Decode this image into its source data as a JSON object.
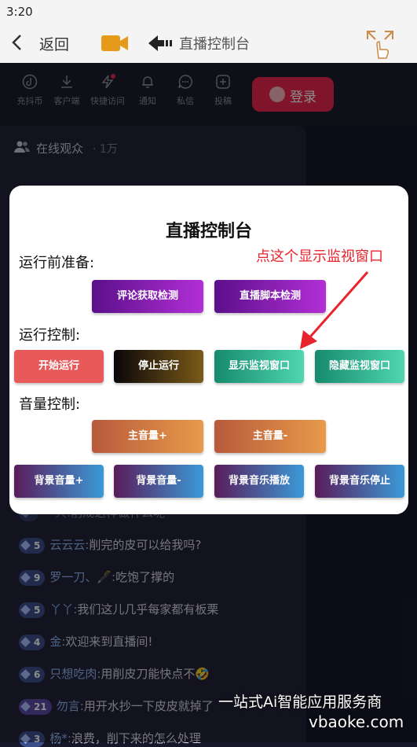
{
  "status": {
    "time": "3:20"
  },
  "header": {
    "back_label": "返回",
    "title": "直播控制台"
  },
  "appbar": {
    "items": [
      {
        "label": "充抖币",
        "icon": "tiktok-icon"
      },
      {
        "label": "客户端",
        "icon": "download-icon"
      },
      {
        "label": "快捷访问",
        "icon": "lightning-icon"
      },
      {
        "label": "通知",
        "icon": "bell-icon"
      },
      {
        "label": "私信",
        "icon": "chat-icon"
      },
      {
        "label": "投稿",
        "icon": "plus-square-icon"
      }
    ],
    "login_label": "登录"
  },
  "panel": {
    "audience_label": "在线观众",
    "audience_count": "· 1万"
  },
  "modal": {
    "title": "直播控制台",
    "annotation": "点这个显示监视窗口",
    "sections": [
      {
        "label": "运行前准备:",
        "buttons": [
          "评论获取检测",
          "直播脚本检测"
        ]
      },
      {
        "label": "运行控制:",
        "buttons": [
          "开始运行",
          "停止运行",
          "显示监视窗口",
          "隐藏监视窗口"
        ]
      },
      {
        "label": "音量控制:",
        "buttons": [
          "主音量+",
          "主音量-",
          "背景音量+",
          "背景音量-",
          "背景音乐播放",
          "背景音乐停止"
        ]
      }
    ]
  },
  "comments": [
    {
      "level": "",
      "user": "一只:",
      "text": "削成这样做什么呢"
    },
    {
      "level": "5",
      "user": "云云云:",
      "text": "削完的皮可以给我吗?"
    },
    {
      "level": "9",
      "user": "罗一刀、🖋️:",
      "text": "吃饱了撑的"
    },
    {
      "level": "5",
      "user": "丫丫:",
      "text": "我们这儿几乎每家都有板栗"
    },
    {
      "level": "4",
      "user": "金:",
      "text": "欢迎来到直播间!"
    },
    {
      "level": "6",
      "user": "只想吃肉:",
      "text": "用削皮刀能快点不🤣"
    },
    {
      "level": "21",
      "user": "勿言:",
      "text": "用开水抄一下皮皮就掉了"
    },
    {
      "level": "3",
      "user": "杨*:",
      "text": "浪费，削下来的怎么处理"
    }
  ],
  "watermark": {
    "line1": "一站式Ai智能应用服务商",
    "line2": "vbaoke.com"
  },
  "colors": {
    "accent": "#e8264d",
    "annotation": "#e8232d",
    "panel": "#23233a"
  }
}
